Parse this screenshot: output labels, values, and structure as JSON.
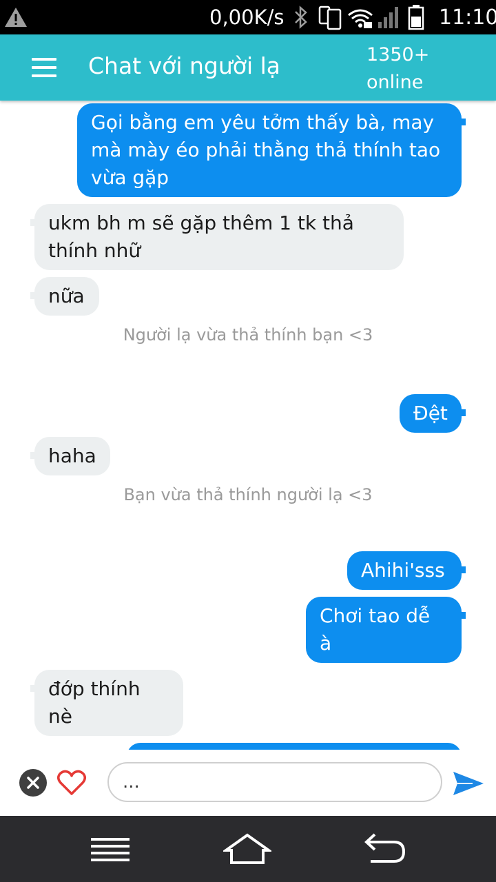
{
  "status_bar": {
    "speed": "0,00K/s",
    "time": "11:10",
    "icons": [
      "warning-icon",
      "bluetooth-icon",
      "phone-icon",
      "wifi-icon",
      "signal-icon",
      "battery-icon"
    ]
  },
  "app_bar": {
    "title": "Chat với người lạ",
    "online_count": "1350+",
    "online_label": "online",
    "color": "#2dbdcb"
  },
  "messages": [
    {
      "side": "out",
      "text": "Gọi bằng em yêu tởm thấy bà, may mà mày éo phải thằng thả thính tao vừa gặp"
    },
    {
      "side": "in",
      "text": "ukm bh m sẽ gặp thêm 1 tk thả thính nhữ"
    },
    {
      "side": "in",
      "text": "nữa"
    },
    {
      "side": "system",
      "text": "Người lạ vừa thả thính bạn <3"
    },
    {
      "side": "out",
      "text": "Đệt"
    },
    {
      "side": "in",
      "text": "haha"
    },
    {
      "side": "system",
      "text": "Bạn vừa thả thính người lạ <3"
    },
    {
      "side": "out",
      "text": "Ahihi'sss"
    },
    {
      "side": "out",
      "text": "Chơi tao dễ à"
    },
    {
      "side": "in",
      "text": "đớp thính nè"
    }
  ],
  "colors": {
    "outgoing_bubble": "#0d8eef",
    "incoming_bubble": "#eceff0",
    "send_icon": "#1e88e5",
    "heart_icon": "#e53935"
  },
  "composer": {
    "value": "..."
  },
  "nav": {
    "icons": [
      "menu-lines-icon",
      "home-icon",
      "back-arrow-icon"
    ]
  }
}
